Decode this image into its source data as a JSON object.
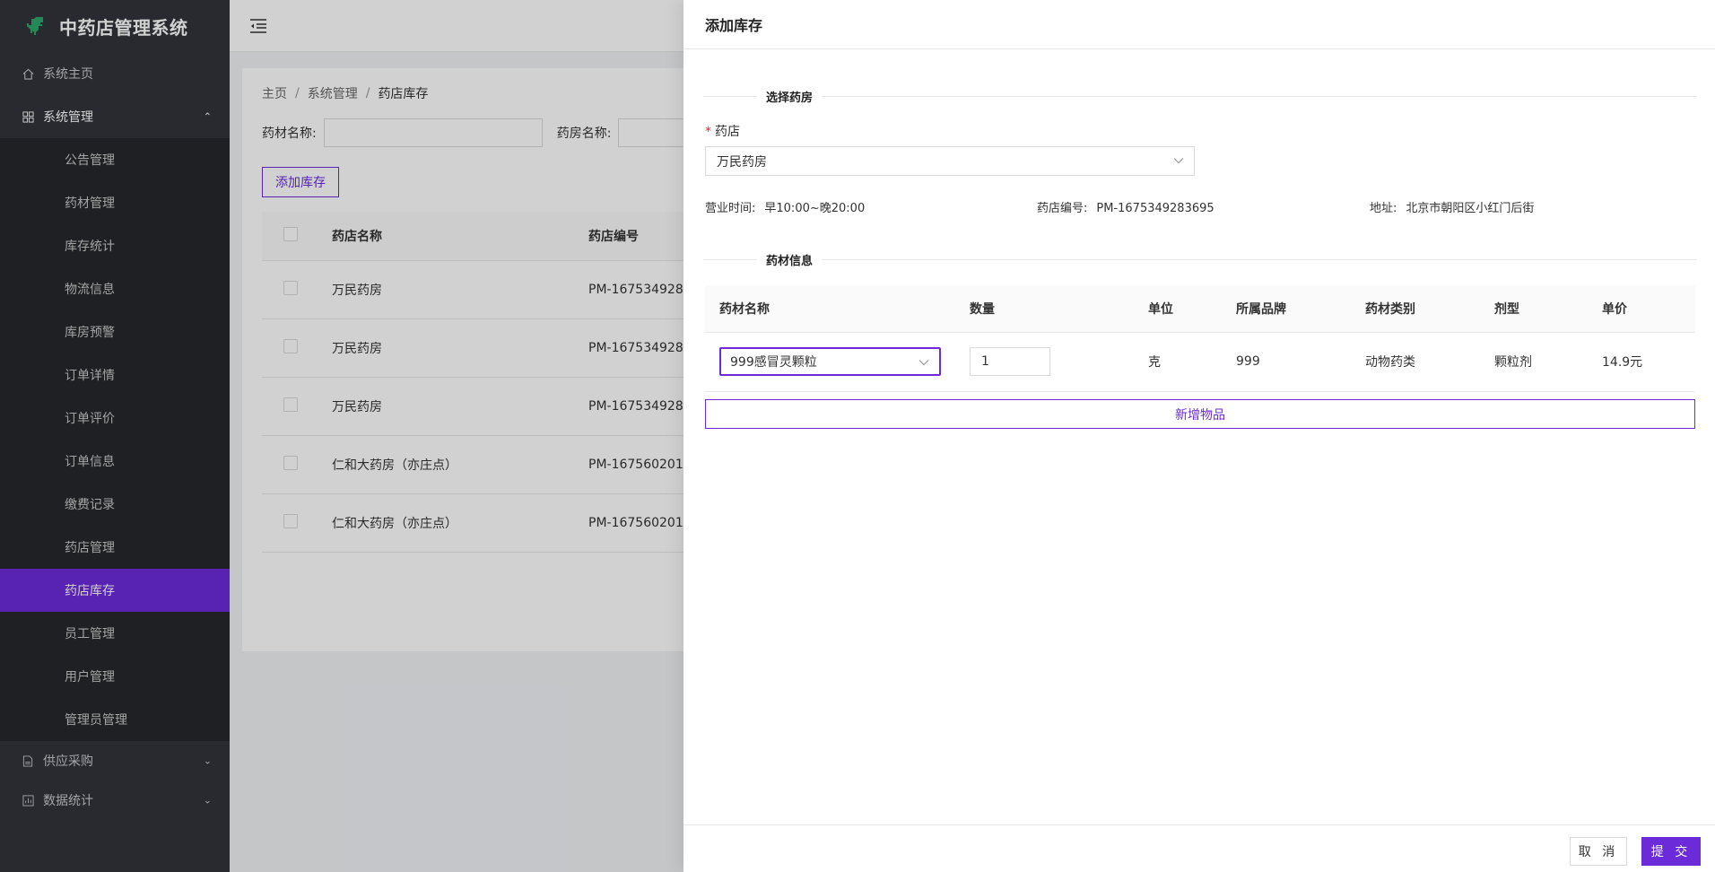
{
  "app": {
    "title": "中药店管理系统"
  },
  "sidebar": {
    "home": "系统主页",
    "system": {
      "label": "系统管理",
      "items": [
        "公告管理",
        "药材管理",
        "库存统计",
        "物流信息",
        "库房预警",
        "订单详情",
        "订单评价",
        "订单信息",
        "缴费记录",
        "药店管理",
        "药店库存",
        "员工管理",
        "用户管理",
        "管理员管理"
      ],
      "active": "药店库存"
    },
    "supply": "供应采购",
    "stats": "数据统计"
  },
  "breadcrumb": [
    "主页",
    "系统管理",
    "药店库存"
  ],
  "search": {
    "medicine_label": "药材名称:",
    "pharmacy_label": "药房名称:"
  },
  "toolbar": {
    "add_label": "添加库存"
  },
  "list": {
    "columns": [
      "药店名称",
      "药店编号"
    ],
    "rows": [
      [
        "万民药房",
        "PM-167534928"
      ],
      [
        "万民药房",
        "PM-167534928"
      ],
      [
        "万民药房",
        "PM-167534928"
      ],
      [
        "仁和大药房（亦庄点）",
        "PM-167560201"
      ],
      [
        "仁和大药房（亦庄点）",
        "PM-167560201"
      ]
    ]
  },
  "drawer": {
    "title": "添加库存",
    "section_pharmacy": "选择药房",
    "pharmacy_label": "药店",
    "pharmacy_value": "万民药房",
    "info": {
      "hours_key": "营业时间:",
      "hours_val": "早10:00~晚20:00",
      "code_key": "药店编号:",
      "code_val": "PM-1675349283695",
      "addr_key": "地址:",
      "addr_val": "北京市朝阳区小红门后街"
    },
    "section_medicine": "药材信息",
    "goods_columns": [
      "药材名称",
      "数量",
      "单位",
      "所属品牌",
      "药材类别",
      "剂型",
      "单价"
    ],
    "goods_row": {
      "name": "999感冒灵颗粒",
      "qty": "1",
      "unit": "克",
      "brand": "999",
      "category": "动物药类",
      "form": "颗粒剂",
      "price": "14.9元"
    },
    "add_item": "新增物品",
    "cancel": "取 消",
    "submit": "提 交"
  },
  "colors": {
    "accent": "#6c2bd9",
    "sidebar_bg": "#31343a",
    "submenu_bg": "#26282d"
  }
}
